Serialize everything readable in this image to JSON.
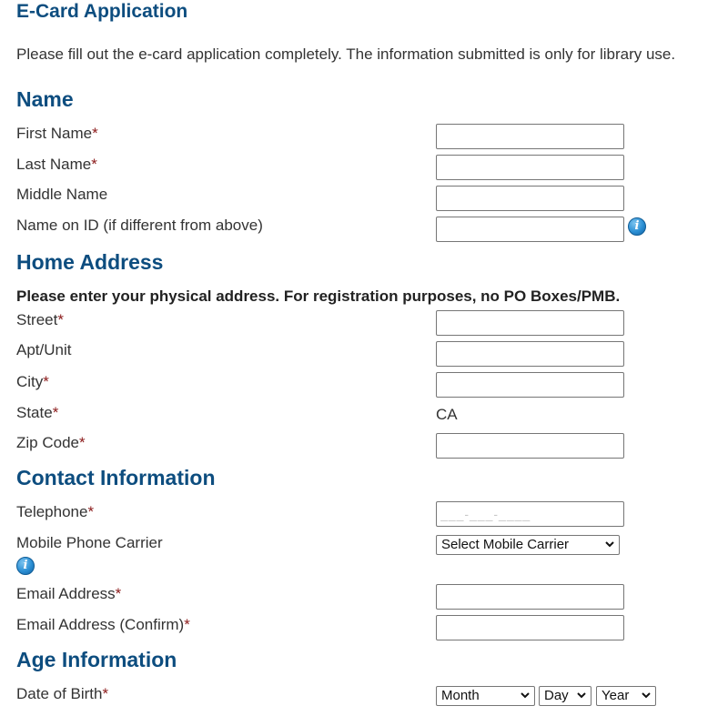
{
  "header": {
    "title": "E-Card Application",
    "intro": "Please fill out the e-card application completely. The information submitted is only for library use."
  },
  "required_marker": "*",
  "sections": {
    "name": {
      "heading": "Name",
      "first_name_label": "First Name",
      "last_name_label": "Last Name",
      "middle_name_label": "Middle Name",
      "name_on_id_label": "Name on ID (if different from above)"
    },
    "address": {
      "heading": "Home Address",
      "notice": "Please enter your physical address. For registration purposes, no PO Boxes/PMB.",
      "street_label": "Street",
      "apt_label": "Apt/Unit",
      "city_label": "City",
      "state_label": "State",
      "state_value": "CA",
      "zip_label": "Zip Code"
    },
    "contact": {
      "heading": "Contact Information",
      "telephone_label": "Telephone",
      "telephone_placeholder": "___-___-____",
      "carrier_label": "Mobile Phone Carrier",
      "carrier_selected": "Select Mobile Carrier",
      "email_label": "Email Address",
      "email_confirm_label": "Email Address (Confirm)"
    },
    "age": {
      "heading": "Age Information",
      "dob_label": "Date of Birth",
      "month_selected": "Month",
      "day_selected": "Day",
      "year_selected": "Year"
    }
  },
  "icons": {
    "info": "info-icon",
    "info_glyph": "i",
    "dropdown": "chevron-down-icon"
  },
  "colors": {
    "heading": "#0d4d7f",
    "required": "#8b1a1a",
    "info_icon": "#2b8fd4"
  }
}
